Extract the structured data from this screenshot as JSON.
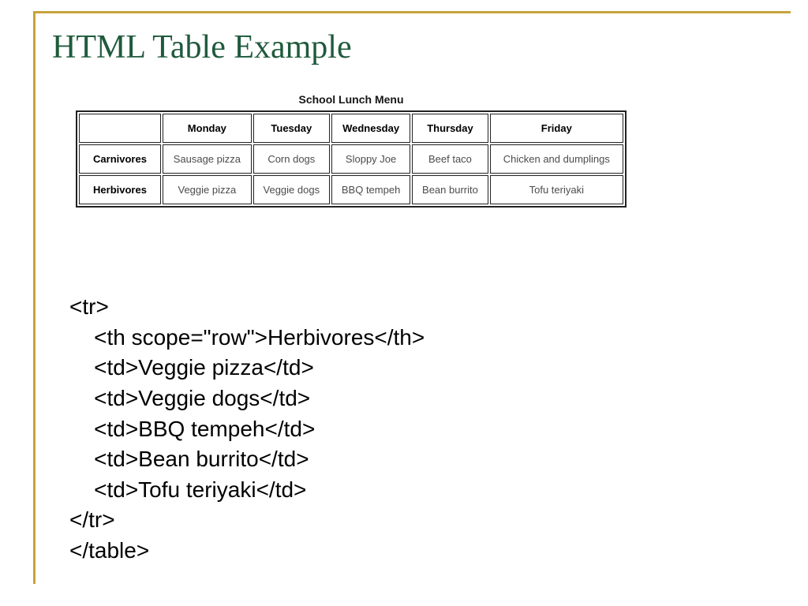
{
  "title": "HTML Table Example",
  "table": {
    "caption": "School Lunch Menu",
    "headers": [
      "Monday",
      "Tuesday",
      "Wednesday",
      "Thursday",
      "Friday"
    ],
    "rows": [
      {
        "label": "Carnivores",
        "cells": [
          "Sausage pizza",
          "Corn dogs",
          "Sloppy Joe",
          "Beef taco",
          "Chicken and dumplings"
        ]
      },
      {
        "label": "Herbivores",
        "cells": [
          "Veggie pizza",
          "Veggie dogs",
          "BBQ tempeh",
          "Bean burrito",
          "Tofu teriyaki"
        ]
      }
    ]
  },
  "code": {
    "l0": "<tr>",
    "l1": "    <th scope=\"row\">Herbivores</th>",
    "l2": "    <td>Veggie pizza</td>",
    "l3": "    <td>Veggie dogs</td>",
    "l4": "    <td>BBQ tempeh</td>",
    "l5": "    <td>Bean burrito</td>",
    "l6": "    <td>Tofu teriyaki</td>",
    "l7": "</tr>",
    "l8": "</table>"
  },
  "chart_data": {
    "type": "table",
    "title": "School Lunch Menu",
    "columns": [
      "",
      "Monday",
      "Tuesday",
      "Wednesday",
      "Thursday",
      "Friday"
    ],
    "rows": [
      [
        "Carnivores",
        "Sausage pizza",
        "Corn dogs",
        "Sloppy Joe",
        "Beef taco",
        "Chicken and dumplings"
      ],
      [
        "Herbivores",
        "Veggie pizza",
        "Veggie dogs",
        "BBQ tempeh",
        "Bean burrito",
        "Tofu teriyaki"
      ]
    ]
  }
}
